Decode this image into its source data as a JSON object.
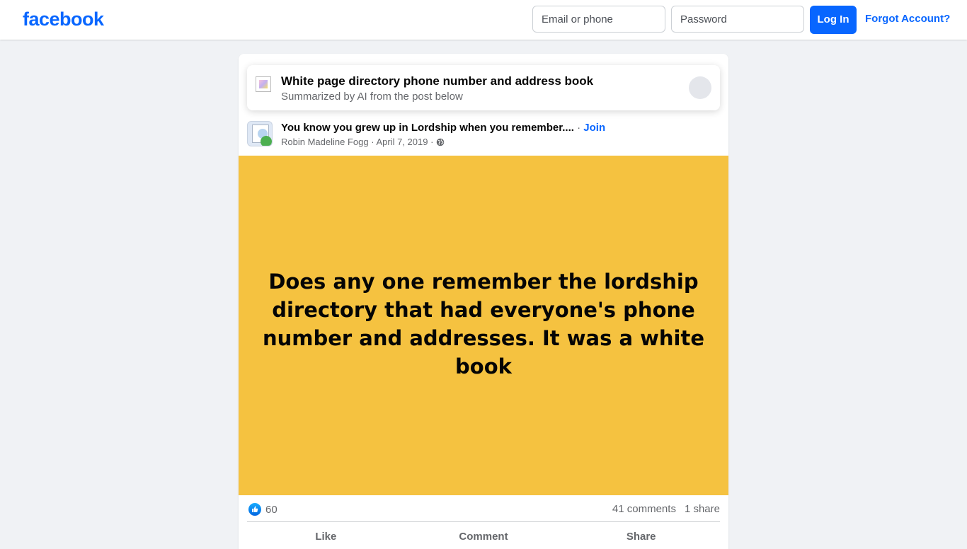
{
  "header": {
    "logo": "facebook",
    "email_placeholder": "Email or phone",
    "password_placeholder": "Password",
    "login_label": "Log In",
    "forgot_label": "Forgot Account?"
  },
  "summary": {
    "title": "White page directory phone number and address book",
    "subtitle": "Summarized by AI from the post below"
  },
  "post": {
    "group_title": "You know you grew up in Lordship when you remember....",
    "separator": "·",
    "join_label": "Join",
    "author": "Robin Madeline Fogg",
    "date": "April 7, 2019",
    "body": "Does any one remember the lordship directory that had everyone's phone number and addresses. It was a white book",
    "background_color": "#f5c240",
    "reaction_count": "60",
    "comments": "41 comments",
    "shares": "1 share"
  },
  "actions": {
    "like": "Like",
    "comment": "Comment",
    "share": "Share"
  },
  "colors": {
    "brand": "#0866ff",
    "page_bg": "#f0f2f5"
  }
}
